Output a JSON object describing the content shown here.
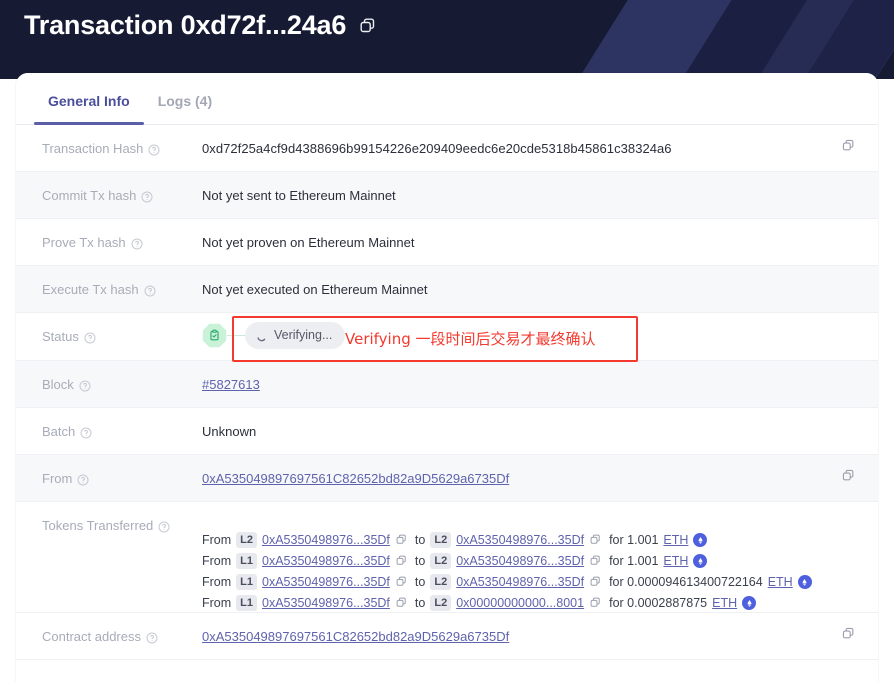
{
  "header": {
    "title": "Transaction 0xd72f...24a6",
    "copy_icon": "copy-icon"
  },
  "tabs": [
    {
      "label": "General Info",
      "active": true
    },
    {
      "label": "Logs (4)",
      "active": false
    }
  ],
  "colors": {
    "header_bg": "#161b33",
    "accent": "#5b5fa8",
    "link": "#5f63ad",
    "annotation_red": "#f4392f",
    "status_green": "#c9f2d8",
    "eth_blue": "#4f60df"
  },
  "rows": {
    "transaction_hash": {
      "label": "Transaction Hash",
      "value": "0xd72f25a4cf9d4388696b99154226e209409eedc6e20cde5318b45861c38324a6"
    },
    "commit_tx_hash": {
      "label": "Commit Tx hash",
      "value": "Not yet sent to Ethereum Mainnet"
    },
    "prove_tx_hash": {
      "label": "Prove Tx hash",
      "value": "Not yet proven on Ethereum Mainnet"
    },
    "execute_tx_hash": {
      "label": "Execute Tx hash",
      "value": "Not yet executed on Ethereum Mainnet"
    },
    "status": {
      "label": "Status",
      "badge_icon": "clipboard-check-icon",
      "pill_label": "Verifying...",
      "pill_icon": "spinner-icon",
      "annotation": "Verifying 一段时间后交易才最终确认"
    },
    "block": {
      "label": "Block",
      "value": "#5827613"
    },
    "batch": {
      "label": "Batch",
      "value": "Unknown"
    },
    "from": {
      "label": "From",
      "value": "0xA535049897697561C82652bd82a9D5629a6735Df"
    },
    "tokens_transferred": {
      "label": "Tokens Transferred",
      "from_word": "From",
      "to_word": "to",
      "for_word": "for",
      "transfers": [
        {
          "from_layer": "L2",
          "from_address": "0xA5350498976...35Df",
          "to_layer": "L2",
          "to_address": "0xA5350498976...35Df",
          "amount": "1.001",
          "token": "ETH"
        },
        {
          "from_layer": "L1",
          "from_address": "0xA5350498976...35Df",
          "to_layer": "L2",
          "to_address": "0xA5350498976...35Df",
          "amount": "1.001",
          "token": "ETH"
        },
        {
          "from_layer": "L1",
          "from_address": "0xA5350498976...35Df",
          "to_layer": "L2",
          "to_address": "0xA5350498976...35Df",
          "amount": "0.000094613400722164",
          "token": "ETH"
        },
        {
          "from_layer": "L1",
          "from_address": "0xA5350498976...35Df",
          "to_layer": "L2",
          "to_address": "0x00000000000...8001",
          "amount": "0.0002887875",
          "token": "ETH"
        }
      ]
    },
    "contract_address": {
      "label": "Contract address",
      "value": "0xA535049897697561C82652bd82a9D5629a6735Df"
    }
  }
}
